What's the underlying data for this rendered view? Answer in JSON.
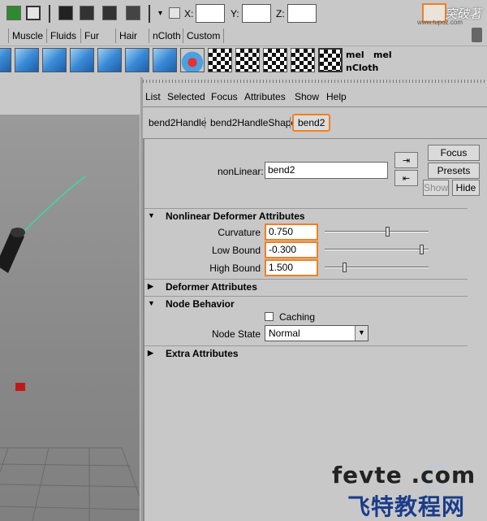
{
  "status_line": {
    "coord_labels": [
      "X:",
      "Y:",
      "Z:"
    ],
    "coord_values": [
      "",
      "",
      ""
    ],
    "logo_text": "突破著",
    "logo_url": "www.tupoz.com"
  },
  "shelf_tabs": [
    "Muscle",
    "Fluids",
    "Fur",
    "Hair",
    "nCloth",
    "Custom"
  ],
  "shelf": {
    "mel_labels": [
      "mel",
      "mel"
    ],
    "ncloth_label": "nCloth"
  },
  "attribute_editor": {
    "menu": [
      "List",
      "Selected",
      "Focus",
      "Attributes",
      "Show",
      "Help"
    ],
    "node_tabs": [
      "bend2Handle",
      "bend2HandleShape",
      "bend2"
    ],
    "active_tab": "bend2",
    "node_type_label": "nonLinear:",
    "node_name": "bend2",
    "buttons": {
      "focus": "Focus",
      "presets": "Presets",
      "show": "Show",
      "hide": "Hide"
    },
    "sections": {
      "nonlinear": "Nonlinear Deformer Attributes",
      "deformer": "Deformer Attributes",
      "node_behavior": "Node Behavior",
      "extra": "Extra Attributes"
    },
    "attributes": {
      "curvature_label": "Curvature",
      "curvature_value": "0.750",
      "curvature_slider": 0.61,
      "low_bound_label": "Low Bound",
      "low_bound_value": "-0.300",
      "low_bound_slider": 0.95,
      "high_bound_label": "High Bound",
      "high_bound_value": "1.500",
      "high_bound_slider": 0.18
    },
    "node_behavior": {
      "caching_label": "Caching",
      "caching_checked": false,
      "node_state_label": "Node State",
      "node_state_value": "Normal"
    }
  },
  "watermark": {
    "line1": "fevte .com",
    "line2": "飞特教程网"
  },
  "colors": {
    "highlight": "#f08020",
    "panel_bg": "#c8c8c8",
    "curve": "#3ad8a8"
  }
}
